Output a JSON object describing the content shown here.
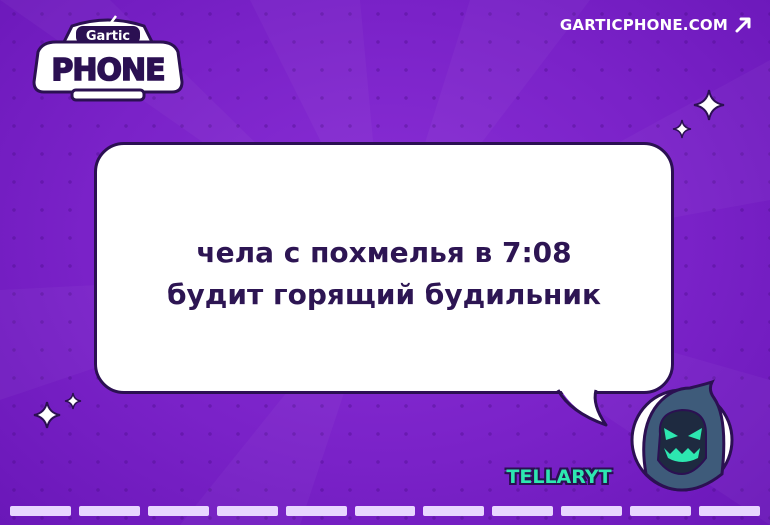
{
  "header": {
    "logo_top_text": "Gartic",
    "logo_main_text": "PHONE",
    "site_link_text": "GARTICPHONE.COM"
  },
  "caption": {
    "line1": "чела с похмелья в 7:08",
    "line2": "будит горящий будильник"
  },
  "player": {
    "name": "TELLARYT",
    "avatar_icon": "hooded-skull-avatar-icon"
  },
  "progress": {
    "total_segments": 11,
    "completed_segments": 11
  },
  "colors": {
    "background": "#7b22c9",
    "text_dark": "#2d1553",
    "player_name": "#2de7b0"
  }
}
